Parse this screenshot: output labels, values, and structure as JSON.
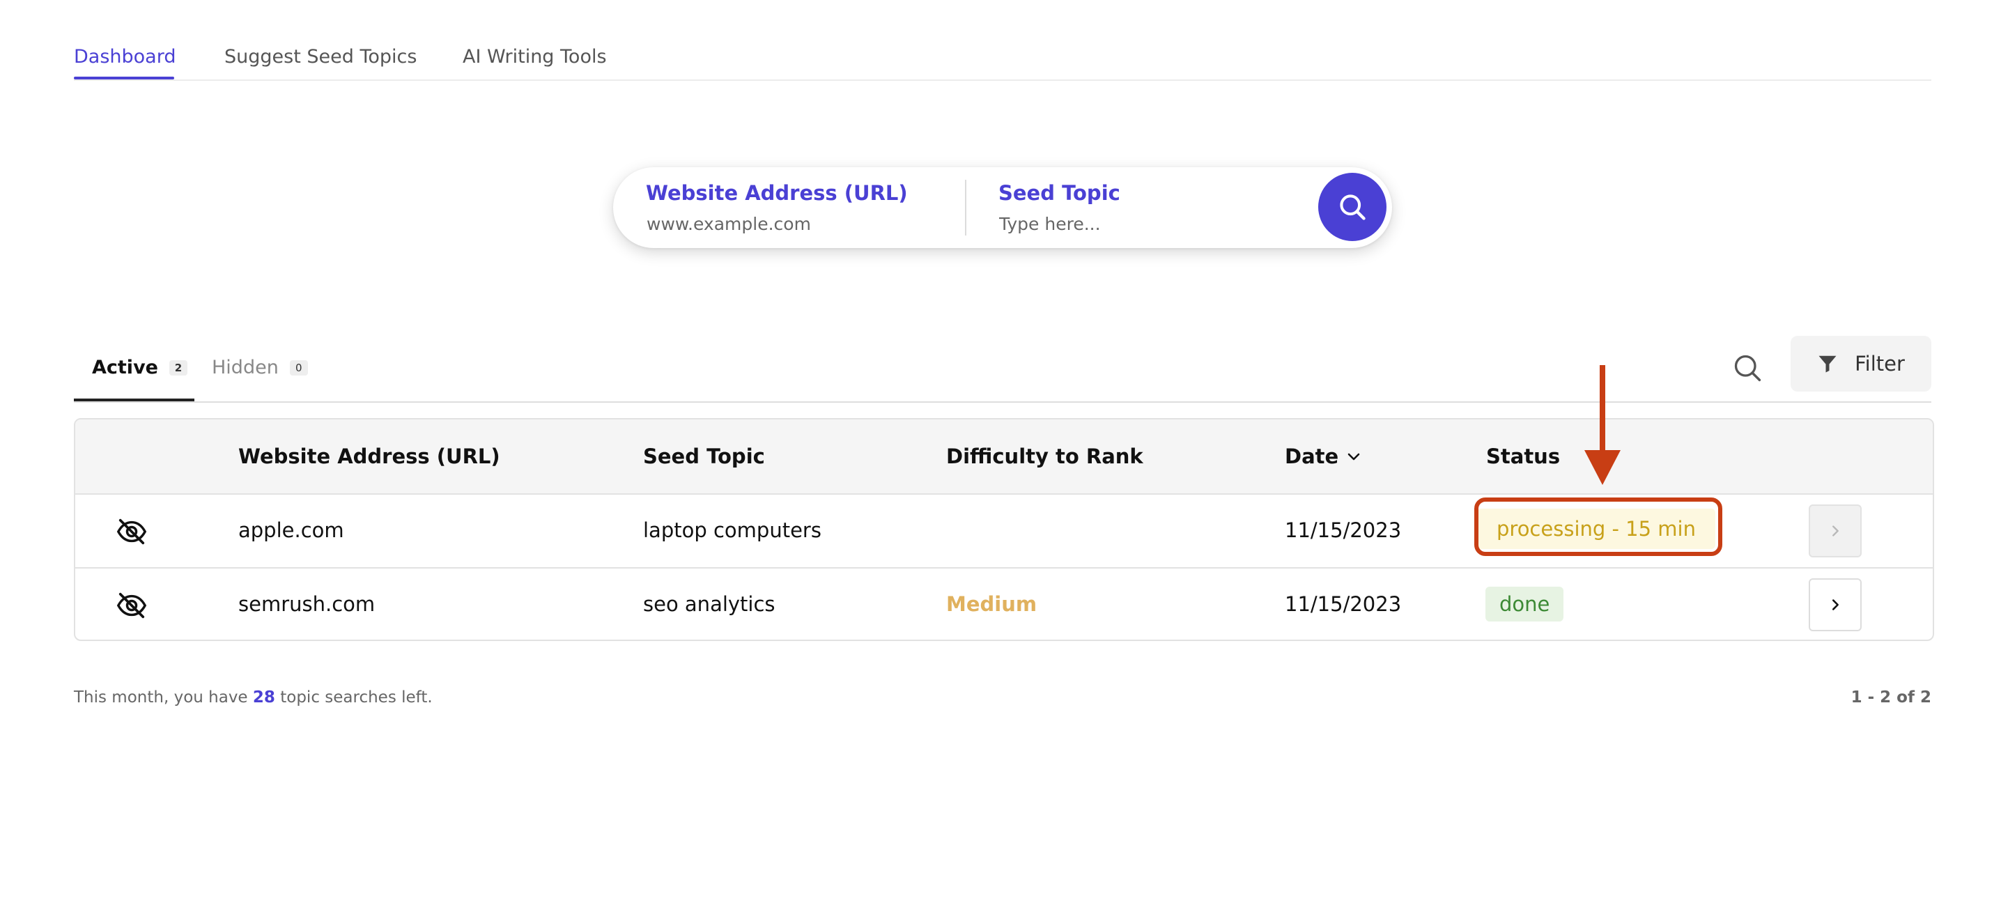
{
  "top_nav": {
    "tabs": [
      {
        "label": "Dashboard",
        "active": true
      },
      {
        "label": "Suggest Seed Topics",
        "active": false
      },
      {
        "label": "AI Writing Tools",
        "active": false
      }
    ]
  },
  "search_bar": {
    "url_label": "Website Address (URL)",
    "url_placeholder": "www.example.com",
    "url_value": "",
    "topic_label": "Seed Topic",
    "topic_placeholder": "Type here...",
    "topic_value": ""
  },
  "list_tabs": [
    {
      "label": "Active",
      "count": "2",
      "active": true
    },
    {
      "label": "Hidden",
      "count": "0",
      "active": false
    }
  ],
  "filter_label": "Filter",
  "table": {
    "headers": {
      "url": "Website Address (URL)",
      "topic": "Seed Topic",
      "difficulty": "Difficulty to Rank",
      "date": "Date",
      "status": "Status"
    },
    "sort": {
      "column": "date",
      "direction": "descending"
    },
    "rows": [
      {
        "url": "apple.com",
        "topic": "laptop computers",
        "difficulty": "",
        "date": "11/15/2023",
        "status": "processing - 15 min",
        "open_enabled": false
      },
      {
        "url": "semrush.com",
        "topic": "seo analytics",
        "difficulty": "Medium",
        "date": "11/15/2023",
        "status": "done",
        "open_enabled": true
      }
    ]
  },
  "footer": {
    "prefix": "This month, you have",
    "count": "28",
    "suffix": "topic searches left.",
    "pagination": "1 - 2 of 2"
  },
  "colors": {
    "accent": "#4a40d4",
    "processing_text": "#c8a11a",
    "processing_bg": "#fdf8e0",
    "done_text": "#3d8a35",
    "done_bg": "#e7f3e3",
    "medium": "#e0b15e",
    "annotation": "#c83e14"
  }
}
